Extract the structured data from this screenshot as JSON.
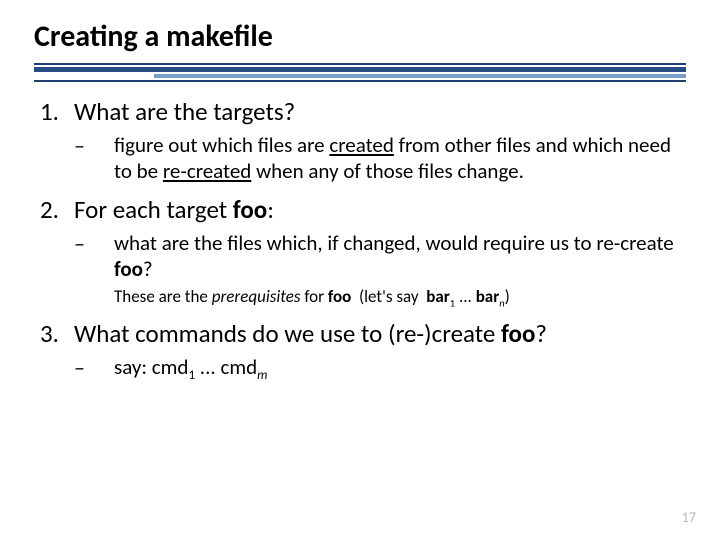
{
  "title": "Creating a makefile",
  "items": [
    {
      "head": [
        {
          "t": "What are the targets?"
        }
      ],
      "subs": [
        {
          "segments": [
            {
              "t": "figure out which files are "
            },
            {
              "t": "created",
              "style": "u"
            },
            {
              "t": " from other files and which need to be "
            },
            {
              "t": "re-created",
              "style": "u"
            },
            {
              "t": " when any of those files change."
            }
          ]
        }
      ]
    },
    {
      "head": [
        {
          "t": "For each target "
        },
        {
          "t": "foo",
          "style": "b"
        },
        {
          "t": ":"
        }
      ],
      "subs": [
        {
          "segments": [
            {
              "t": "what are the files which, if changed, would require us to re-create "
            },
            {
              "t": "foo",
              "style": "b"
            },
            {
              "t": "?"
            }
          ],
          "note": [
            {
              "t": "These are the "
            },
            {
              "t": "prerequisites",
              "style": "i"
            },
            {
              "t": " for "
            },
            {
              "t": "foo",
              "style": "b"
            },
            {
              "t": "  (let's say  "
            },
            {
              "t": "bar",
              "style": "b"
            },
            {
              "t": "1",
              "style": "sub"
            },
            {
              "t": " ... "
            },
            {
              "t": "bar",
              "style": "b"
            },
            {
              "t": "n",
              "style": "sub-i"
            },
            {
              "t": ")"
            }
          ]
        }
      ]
    },
    {
      "head": [
        {
          "t": "What commands do we use to (re-)create "
        },
        {
          "t": "foo",
          "style": "b"
        },
        {
          "t": "?"
        }
      ],
      "subs": [
        {
          "segments": [
            {
              "t": "say: cmd"
            },
            {
              "t": "1",
              "style": "sub"
            },
            {
              "t": " ... cmd"
            },
            {
              "t": "m",
              "style": "sub-i"
            }
          ]
        }
      ]
    }
  ],
  "dash": "–",
  "pagenum": "17"
}
